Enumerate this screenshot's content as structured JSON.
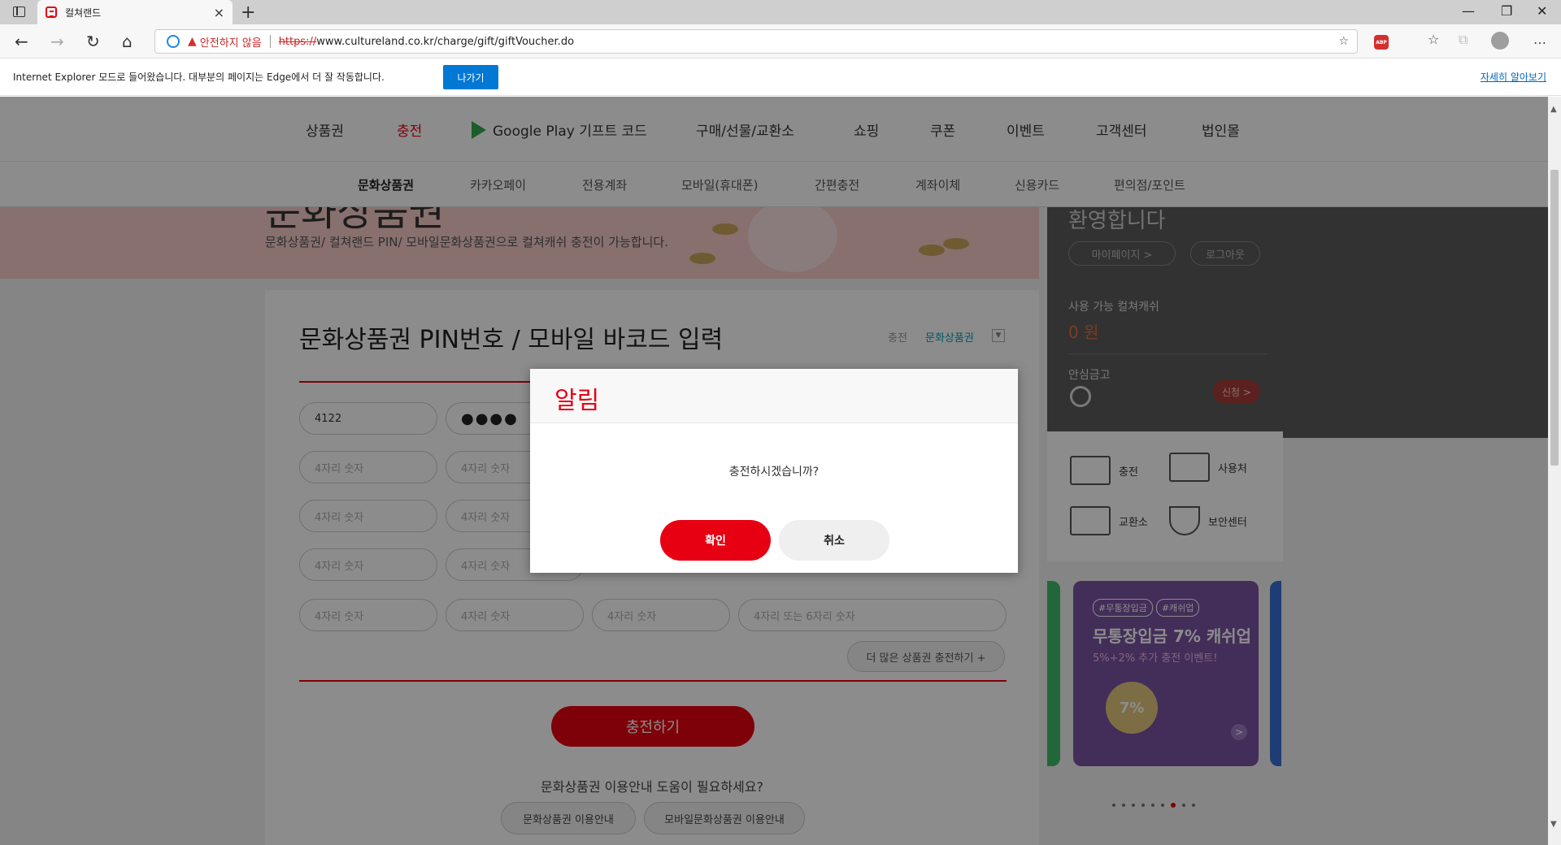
{
  "browser": {
    "tab_title": "컬쳐랜드",
    "new_tab": "+",
    "close_tab": "×",
    "not_secure": "안전하지 않음",
    "url_proto": "https://",
    "url_rest": "www.cultureland.co.kr/charge/gift/giftVoucher.do",
    "abp_label": "ABP",
    "ie_message": "Internet Explorer 모드로 들어왔습니다. 대부분의 페이지는 Edge에서 더 잘 작동합니다.",
    "ie_leave": "나가기",
    "ie_learn_more": "자세히 알아보기"
  },
  "gnb": {
    "items": [
      "상품권",
      "충전",
      "Google Play 기프트 코드",
      "구매/선물/교환소",
      "쇼핑",
      "쿠폰",
      "이벤트",
      "고객센터",
      "법인몰"
    ]
  },
  "subnav": {
    "items": [
      "문화상품권",
      "카카오페이",
      "전용계좌",
      "모바일(휴대폰)",
      "간편충전",
      "계좌이체",
      "신용카드",
      "편의점/포인트"
    ]
  },
  "banner": {
    "title": "문화상품권",
    "desc": "문화상품권/ 컬쳐랜드 PIN/ 모바일문화상품권으로 컬쳐캐쉬 충전이 가능합니다."
  },
  "side": {
    "welcome": "환영합니다",
    "mypage": "마이페이지 >",
    "logout": "로그아웃",
    "cash_label": "사용 가능 컬쳐캐쉬",
    "cash_value": "0 원",
    "safe_label": "안심금고",
    "apply": "신청 >"
  },
  "quick": {
    "charge": "충전",
    "usage": "사용처",
    "exchange": "교환소",
    "security": "보안센터"
  },
  "promo": {
    "tag1": "#무통장입금",
    "tag2": "#캐쉬업",
    "headline": "무통장입금 7% 캐쉬업",
    "desc": "5%+2% 추가 충전 이벤트!",
    "medal": "7%",
    "next": ">"
  },
  "content": {
    "title": "문화상품권 PIN번호 / 모바일 바코드 입력",
    "crumb_parent": "충전",
    "crumb_current": "문화상품권",
    "pin_first": "4122",
    "pin_masked": "●●●●",
    "pin_placeholder": "4자리 숫자",
    "pin_placeholder_last": "4자리 또는 6자리 숫자",
    "more_btn": "더 많은 상품권 충전하기 +",
    "charge_btn": "충전하기",
    "help_text": "문화상품권 이용안내 도움이 필요하세요?",
    "help_btn1": "문화상품권 이용안내",
    "help_btn2": "모바일문화상품권 이용안내"
  },
  "modal": {
    "title": "알림",
    "message": "충전하시겠습니까?",
    "ok": "확인",
    "cancel": "취소"
  }
}
